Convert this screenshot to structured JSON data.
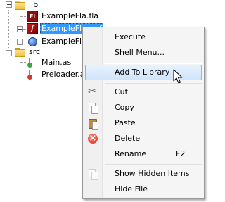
{
  "tree": {
    "items": [
      {
        "label": "lib",
        "icon": "folder-icon"
      },
      {
        "label": "ExampleFla.fla",
        "icon": "fla-file-icon",
        "icon_text": "Fl"
      },
      {
        "label": "ExampleFla.swf",
        "icon": "swf-file-icon",
        "icon_text": "f"
      },
      {
        "label": "ExampleFla.swf",
        "icon": "swf-debug-file-icon"
      },
      {
        "label": "src",
        "icon": "folder-icon"
      },
      {
        "label": "Main.as",
        "icon": "actionscript-file-icon"
      },
      {
        "label": "Preloader.as",
        "icon": "actionscript-file-icon"
      }
    ]
  },
  "context_menu": {
    "items": [
      {
        "label": "Execute",
        "shortcut": ""
      },
      {
        "label": "Shell Menu...",
        "shortcut": ""
      },
      {
        "label": "Add To Library",
        "shortcut": ""
      },
      {
        "label": "Cut",
        "shortcut": "",
        "icon": "scissors-icon"
      },
      {
        "label": "Copy",
        "shortcut": "",
        "icon": "copy-icon"
      },
      {
        "label": "Paste",
        "shortcut": "",
        "icon": "paste-icon"
      },
      {
        "label": "Delete",
        "shortcut": "",
        "icon": "delete-icon"
      },
      {
        "label": "Rename",
        "shortcut": "F2"
      },
      {
        "label": "Show Hidden Items",
        "shortcut": "",
        "icon": "hidden-items-icon"
      },
      {
        "label": "Hide File",
        "shortcut": ""
      }
    ],
    "highlighted": "Add To Library"
  },
  "colors": {
    "selection": "#3399ff",
    "menu_highlight_border": "#8fb6e6",
    "fla_icon": "#8a0f0f"
  }
}
